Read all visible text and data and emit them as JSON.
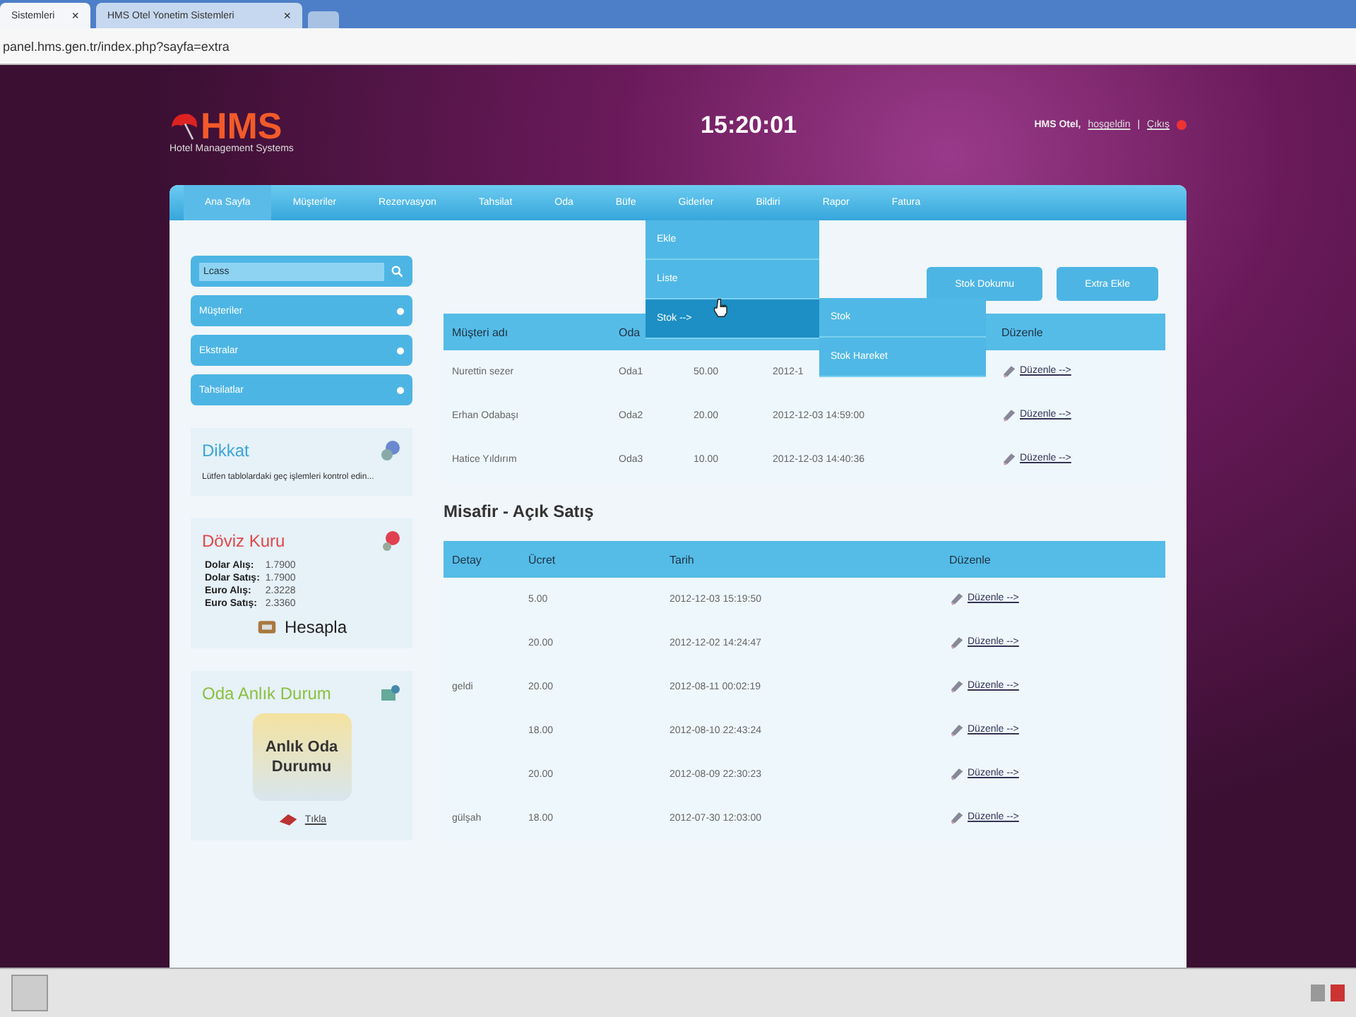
{
  "browser": {
    "tabs": [
      {
        "label": "Sistemleri",
        "close": "×",
        "selected": true
      },
      {
        "label": "HMS Otel Yonetim Sistemleri",
        "close": "×",
        "selected": false
      }
    ],
    "address": "panel.hms.gen.tr/index.php?sayfa=extra"
  },
  "header": {
    "logo": "HMS",
    "tagline": "Hotel Management Systems",
    "clock": "15:20:01",
    "user": "HMS Otel,",
    "welcome": "hoşgeldin",
    "separator": "|",
    "logout": "Çıkış"
  },
  "nav": [
    {
      "label": "Ana Sayfa",
      "selected": true
    },
    {
      "label": "Müşteriler",
      "selected": false
    },
    {
      "label": "Rezervasyon",
      "selected": false
    },
    {
      "label": "Tahsilat",
      "selected": false
    },
    {
      "label": "Oda",
      "selected": false
    },
    {
      "label": "Büfe",
      "selected": false
    },
    {
      "label": "Giderler",
      "selected": false
    },
    {
      "label": "Bildiri",
      "selected": false
    },
    {
      "label": "Rapor",
      "selected": false
    },
    {
      "label": "Fatura",
      "selected": false
    }
  ],
  "dropdown": {
    "items": [
      {
        "label": "Ekle",
        "selected": false
      },
      {
        "label": "Liste",
        "selected": false
      },
      {
        "label": "Stok -->",
        "selected": true
      }
    ],
    "submenu": [
      {
        "label": "Stok"
      },
      {
        "label": "Stok Hareket"
      }
    ]
  },
  "sidebar": {
    "search": {
      "value": "Lcass"
    },
    "items": [
      {
        "label": "Müşteriler"
      },
      {
        "label": "Ekstralar"
      },
      {
        "label": "Tahsilatlar"
      }
    ],
    "notice": {
      "title": "Dikkat",
      "text": "Lütfen tablolardaki geç işlemleri kontrol edin..."
    },
    "currency": {
      "title": "Döviz Kuru",
      "rates": [
        {
          "label": "Dolar Alış:",
          "value": "1.7900"
        },
        {
          "label": "Dolar Satış:",
          "value": "1.7900"
        },
        {
          "label": "Euro Alış:",
          "value": "2.3228"
        },
        {
          "label": "Euro Satış:",
          "value": "2.3360"
        }
      ],
      "action": "Hesapla"
    },
    "rooms": {
      "title": "Oda Anlık Durum",
      "image_text": "Anlık Oda Durumu",
      "link": "Tıkla"
    }
  },
  "buttons": [
    "Stok Dokumu",
    "Extra Ekle"
  ],
  "table": {
    "columns": [
      "Müşteri adı",
      "Oda",
      null,
      null,
      "Düzenle"
    ],
    "rows": [
      [
        "Nurettin sezer",
        "Oda1",
        "50.00",
        "2012-1",
        "Düzenle -->"
      ],
      [
        "Erhan Odabaşı",
        "Oda2",
        "20.00",
        "2012-12-03 14:59:00",
        "Düzenle -->"
      ],
      [
        "Hatice Yıldırım",
        "Oda3",
        "10.00",
        "2012-12-03 14:40:36",
        "Düzenle -->"
      ]
    ]
  },
  "section_title": "Misafir - Açık Satış",
  "sales": {
    "columns": [
      "Detay",
      "Ücret",
      "Tarih",
      "Düzenle"
    ],
    "rows": [
      [
        "",
        "5.00",
        "2012-12-03 15:19:50",
        "Düzenle -->"
      ],
      [
        "",
        "20.00",
        "2012-12-02 14:24:47",
        "Düzenle -->"
      ],
      [
        "geldi",
        "20.00",
        "2012-08-11 00:02:19",
        "Düzenle -->"
      ],
      [
        "",
        "18.00",
        "2012-08-10 22:43:24",
        "Düzenle -->"
      ],
      [
        "",
        "20.00",
        "2012-08-09 22:30:23",
        "Düzenle -->"
      ],
      [
        "gülşah",
        "18.00",
        "2012-07-30 12:03:00",
        "Düzenle -->"
      ]
    ]
  }
}
